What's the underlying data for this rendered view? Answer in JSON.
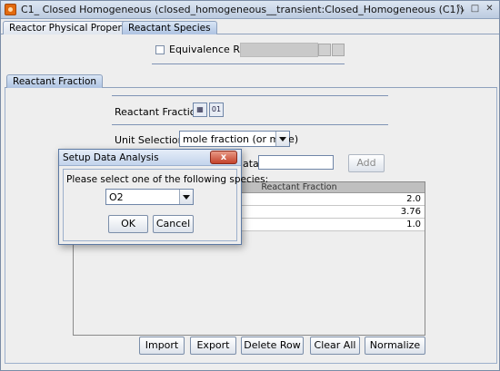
{
  "window": {
    "title": "C1_ Closed Homogeneous  (closed_homogeneous__transient:Closed_Homogeneous (C1))",
    "controls": [
      "restore",
      "maximize",
      "close"
    ]
  },
  "top_tabs": [
    {
      "label": "Reactor Physical Properties",
      "active": false
    },
    {
      "label": "Reactant Species",
      "active": true
    }
  ],
  "equivalence": {
    "label": "Equivalence Ratio",
    "checked": false
  },
  "section_tab": {
    "label": "Reactant Fraction"
  },
  "reactant_fraction": {
    "label": "Reactant Fraction",
    "icons": [
      "chart-icon",
      "binary-data-icon"
    ]
  },
  "unit_selection": {
    "label": "Unit Selection:",
    "value": "mole fraction (or mole)"
  },
  "data_row": {
    "partial_label": "ata",
    "value": "",
    "add_label": "Add"
  },
  "table": {
    "header": "Reactant Fraction",
    "rows": [
      "2.0",
      "3.76",
      "1.0"
    ]
  },
  "actions": [
    "Import",
    "Export",
    "Delete Row",
    "Clear All",
    "Normalize"
  ],
  "dialog": {
    "title": "Setup Data Analysis",
    "close_glyph": "x",
    "prompt": "Please select one of the following species:",
    "species_value": "O2",
    "ok_label": "OK",
    "cancel_label": "Cancel"
  },
  "colors": {
    "accent": "#aec3e2",
    "close_button": "#c4432b",
    "window_border": "#7a8ca6"
  }
}
